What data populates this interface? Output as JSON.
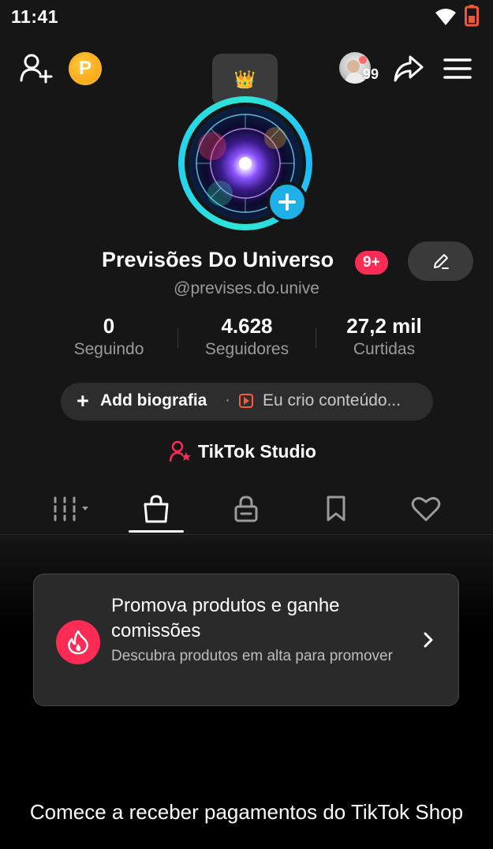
{
  "status_bar": {
    "time": "11:41"
  },
  "header": {
    "coin_letter": "P",
    "friends_count": "99",
    "tooltip_emoji": "👑"
  },
  "profile": {
    "name": "Previsões Do Universo",
    "notification_badge": "9+",
    "handle": "@previses.do.unive"
  },
  "stats": [
    {
      "value": "0",
      "label": "Seguindo"
    },
    {
      "value": "4.628",
      "label": "Seguidores"
    },
    {
      "value": "27,2 mil",
      "label": "Curtidas"
    }
  ],
  "bio": {
    "add_plus": "+",
    "add_label": "Add biografia",
    "separator": "·",
    "creator_label": "Eu crio conteúdo..."
  },
  "studio": {
    "label": "TikTok Studio"
  },
  "tabs": [
    {
      "name": "videos",
      "icon": "grid-icon"
    },
    {
      "name": "shop",
      "icon": "shopping-bag-icon",
      "selected": true
    },
    {
      "name": "private",
      "icon": "lock-icon"
    },
    {
      "name": "saved",
      "icon": "bookmark-icon"
    },
    {
      "name": "liked",
      "icon": "heart-icon"
    }
  ],
  "promo_card": {
    "title": "Promova produtos e ganhe comissões",
    "subtitle": "Descubra produtos em alta para promover"
  },
  "footer": {
    "text": "Comece a receber pagamentos do TikTok Shop"
  },
  "colors": {
    "accent_red": "#fe2c55",
    "ring_cyan": "#2ee6d6",
    "add_blue": "#20b0e8",
    "background": "#161616"
  }
}
